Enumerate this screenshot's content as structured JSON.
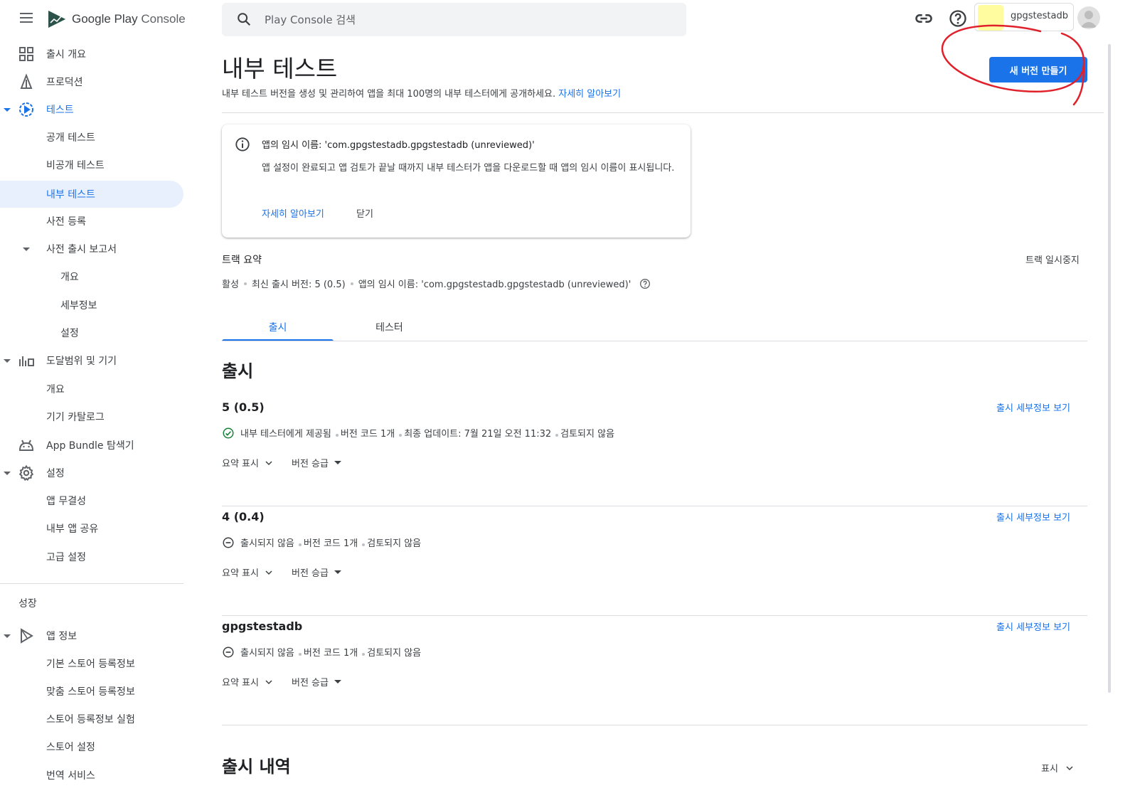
{
  "app": {
    "logo_name": "Google Play",
    "logo_product": "Console"
  },
  "search": {
    "placeholder": "Play Console 검색"
  },
  "account": {
    "name": "gpgstestadb"
  },
  "sidebar": {
    "items": [
      {
        "label": "출시 개요",
        "icon": "dashboard-icon"
      },
      {
        "label": "프로덕션",
        "icon": "production-icon"
      },
      {
        "label": "테스트",
        "icon": "play-circle-icon"
      },
      {
        "label": "공개 테스트"
      },
      {
        "label": "비공개 테스트"
      },
      {
        "label": "내부 테스트"
      },
      {
        "label": "사전 등록"
      },
      {
        "label": "사전 출시 보고서"
      },
      {
        "label": "개요"
      },
      {
        "label": "세부정보"
      },
      {
        "label": "설정"
      },
      {
        "label": "도달범위 및 기기",
        "icon": "bar-chart-icon"
      },
      {
        "label": "개요"
      },
      {
        "label": "기기 카탈로그"
      },
      {
        "label": "App Bundle 탐색기",
        "icon": "android-icon"
      },
      {
        "label": "설정",
        "icon": "gear-icon"
      },
      {
        "label": "앱 무결성"
      },
      {
        "label": "내부 앱 공유"
      },
      {
        "label": "고급 설정"
      }
    ],
    "growth_title": "성장",
    "growth_items": [
      {
        "label": "앱 정보",
        "icon": "play-triangle-icon"
      },
      {
        "label": "기본 스토어 등록정보"
      },
      {
        "label": "맞춤 스토어 등록정보"
      },
      {
        "label": "스토어 등록정보 실험"
      },
      {
        "label": "스토어 설정"
      },
      {
        "label": "번역 서비스"
      }
    ]
  },
  "header": {
    "title": "내부 테스트",
    "description": "내부 테스트 버전을 생성 및 관리하여 앱을 최대 100명의 내부 테스터에게 공개하세요.",
    "learn_more": "자세히 알아보기",
    "new_release_button": "새 버전 만들기"
  },
  "info_card": {
    "title": "앱의 임시 이름: 'com.gpgstestadb.gpgstestadb (unreviewed)'",
    "body": "앱 설정이 완료되고 앱 검토가 끝날 때까지 내부 테스터가 앱을 다운로드할 때 앱의 임시 이름이 표시됩니다.",
    "learn_more": "자세히 알아보기",
    "dismiss": "닫기"
  },
  "track": {
    "title": "트랙 요약",
    "pause": "트랙 일시중지",
    "status": "활성",
    "latest_release": "최신 출시 버전: 5 (0.5)",
    "temp_name": "앱의 임시 이름: 'com.gpgstestadb.gpgstestadb (unreviewed)'"
  },
  "tabs": [
    {
      "label": "출시"
    },
    {
      "label": "테스터"
    }
  ],
  "releases_heading": "출시",
  "releases": [
    {
      "name": "5 (0.5)",
      "status_icon": "check-circle-icon",
      "status": "내부 테스터에게 제공됨",
      "version_codes": "버전 코드 1개",
      "updated": "최종 업데이트: 7월 21일 오전 11:32",
      "review": "검토되지 않음",
      "details_link": "출시 세부정보 보기",
      "summary_action": "요약 표시",
      "promote_action": "버전 승급"
    },
    {
      "name": "4 (0.4)",
      "status_icon": "minus-circle-icon",
      "status": "출시되지 않음",
      "version_codes": "버전 코드 1개",
      "review": "검토되지 않음",
      "details_link": "출시 세부정보 보기",
      "summary_action": "요약 표시",
      "promote_action": "버전 승급"
    },
    {
      "name": "gpgstestadb",
      "status_icon": "minus-circle-icon",
      "status": "출시되지 않음",
      "version_codes": "버전 코드 1개",
      "review": "검토되지 않음",
      "details_link": "출시 세부정보 보기",
      "summary_action": "요약 표시",
      "promote_action": "버전 승급"
    }
  ],
  "history": {
    "title": "출시 내역",
    "show": "표시"
  },
  "colors": {
    "accent": "#1a73e8",
    "annotation": "#e0202a",
    "success": "#188038"
  }
}
